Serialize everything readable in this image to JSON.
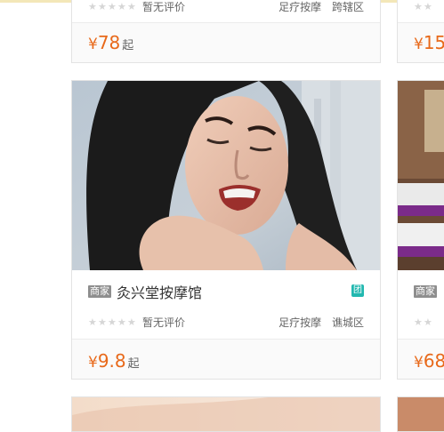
{
  "cards": [
    {
      "meta": {
        "rating_text": "暂无评价",
        "category": "足疗按摩",
        "district": "跨辖区"
      },
      "price": {
        "symbol": "¥",
        "value": "78",
        "suffix": "起"
      }
    },
    {
      "tag": "商家",
      "name": "灸兴堂按摩馆",
      "group_icon_text": "团",
      "meta": {
        "rating_text": "暂无评价",
        "category": "足疗按摩",
        "district": "谯城区"
      },
      "price": {
        "symbol": "¥",
        "value": "9.8",
        "suffix": "起"
      }
    }
  ],
  "side_cards": [
    {
      "price": {
        "symbol": "¥",
        "value": "15"
      }
    },
    {
      "tag": "商家",
      "price": {
        "symbol": "¥",
        "value": "68"
      }
    }
  ],
  "colors": {
    "price": "#e8691a",
    "tag_bg": "#8e8e8e",
    "group_icon": "#22b8b0",
    "star_empty": "#d6d6d6"
  },
  "icons": {
    "rating": "star-icon",
    "group": "tuan-group-icon"
  }
}
